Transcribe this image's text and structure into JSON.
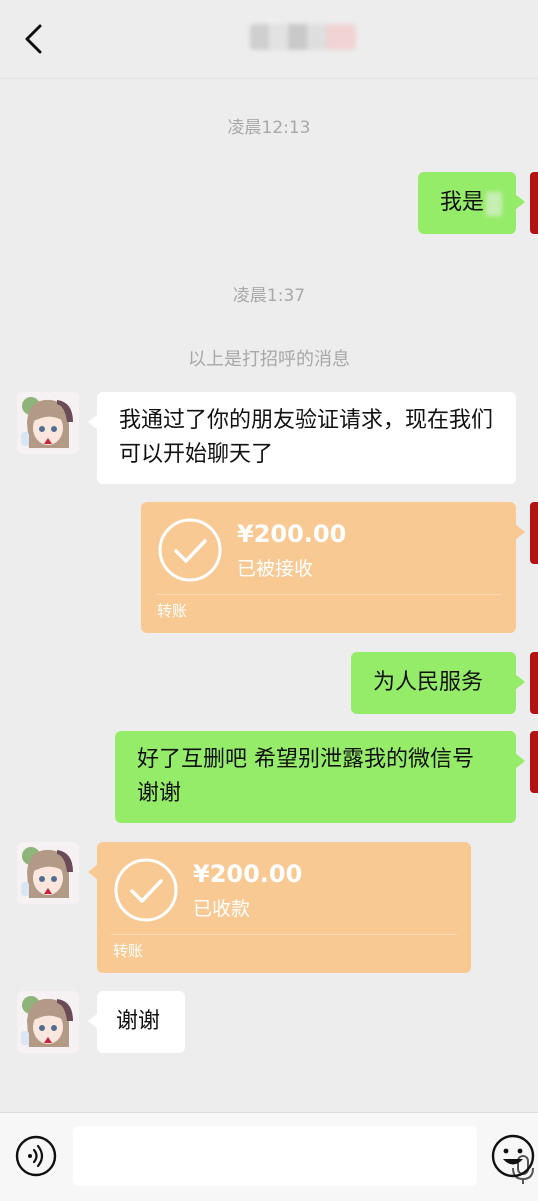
{
  "header": {
    "back_icon": "chevron-left-icon"
  },
  "chat": {
    "time1": "凌晨12:13",
    "msg_me_1": "我是",
    "time2": "凌晨1:37",
    "system_note": "以上是打招呼的消息",
    "msg_friend_1": "我通过了你的朋友验证请求，现在我们可以开始聊天了",
    "transfer_1": {
      "amount": "¥200.00",
      "status": "已被接收",
      "kind": "转账"
    },
    "msg_me_2": "为人民服务",
    "msg_me_3": "好了互删吧 希望别泄露我的微信号 谢谢",
    "transfer_2": {
      "amount": "¥200.00",
      "status": "已收款",
      "kind": "转账"
    },
    "msg_friend_2": "谢谢"
  },
  "bottom": {
    "voice_icon": "voice-icon",
    "mic_icon": "microphone-icon",
    "emoji_icon": "emoji-icon"
  },
  "colors": {
    "green_bubble": "#95ec69",
    "transfer": "#f9c994",
    "background": "#ededed"
  }
}
